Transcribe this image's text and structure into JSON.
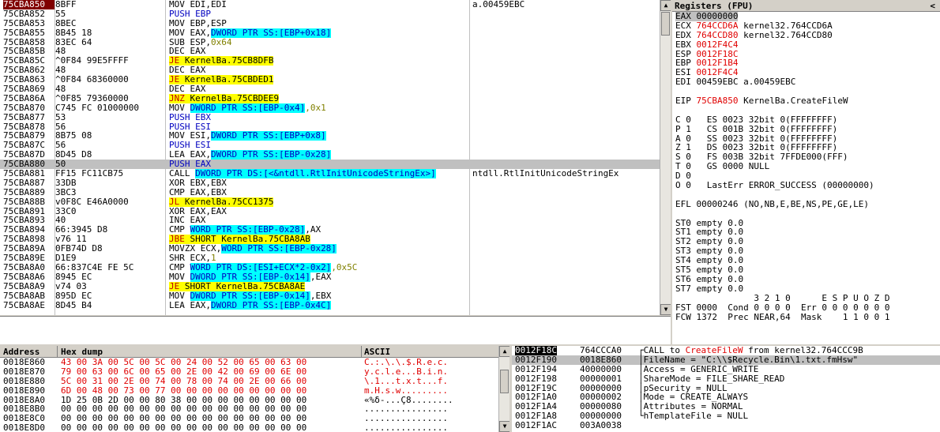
{
  "cpu": {
    "rows": [
      {
        "addr": "75CBA850",
        "hex": "8BFF",
        "dis": "MOV EDI,EDI",
        "cmt": "a.00459EBC",
        "eip": true
      },
      {
        "addr": "75CBA852",
        "hex": "55",
        "dis": "PUSH EBP",
        "cmt": ""
      },
      {
        "addr": "75CBA853",
        "hex": "8BEC",
        "dis": "MOV EBP,ESP",
        "cmt": ""
      },
      {
        "addr": "75CBA855",
        "hex": "8B45 18",
        "dis": "MOV EAX,DWORD PTR SS:[EBP+0x18]",
        "cmt": ""
      },
      {
        "addr": "75CBA858",
        "hex": "83EC 64",
        "dis": "SUB ESP,0x64",
        "cmt": ""
      },
      {
        "addr": "75CBA85B",
        "hex": "48",
        "dis": "DEC EAX",
        "cmt": ""
      },
      {
        "addr": "75CBA85C",
        "hex": "^0F84 99E5FFFF",
        "dis": "JE KernelBa.75CB8DFB",
        "cmt": ""
      },
      {
        "addr": "75CBA862",
        "hex": "48",
        "dis": "DEC EAX",
        "cmt": ""
      },
      {
        "addr": "75CBA863",
        "hex": "^0F84 68360000",
        "dis": "JE KernelBa.75CBDED1",
        "cmt": ""
      },
      {
        "addr": "75CBA869",
        "hex": "48",
        "dis": "DEC EAX",
        "cmt": ""
      },
      {
        "addr": "75CBA86A",
        "hex": "^0F85 79360000",
        "dis": "JNZ KernelBa.75CBDEE9",
        "cmt": ""
      },
      {
        "addr": "75CBA870",
        "hex": "C745 FC 01000000",
        "dis": "MOV DWORD PTR SS:[EBP-0x4],0x1",
        "cmt": ""
      },
      {
        "addr": "75CBA877",
        "hex": "53",
        "dis": "PUSH EBX",
        "cmt": ""
      },
      {
        "addr": "75CBA878",
        "hex": "56",
        "dis": "PUSH ESI",
        "cmt": ""
      },
      {
        "addr": "75CBA879",
        "hex": "8B75 08",
        "dis": "MOV ESI,DWORD PTR SS:[EBP+0x8]",
        "cmt": ""
      },
      {
        "addr": "75CBA87C",
        "hex": "56",
        "dis": "PUSH ESI",
        "cmt": ""
      },
      {
        "addr": "75CBA87D",
        "hex": "8D45 D8",
        "dis": "LEA EAX,DWORD PTR SS:[EBP-0x28]",
        "cmt": ""
      },
      {
        "addr": "75CBA880",
        "hex": "50",
        "dis": "PUSH EAX",
        "cmt": "",
        "sel": true
      },
      {
        "addr": "75CBA881",
        "hex": "FF15 FC11CB75",
        "dis": "CALL DWORD PTR DS:[<&ntdll.RtlInitUnicodeStringEx>]",
        "cmt": "ntdll.RtlInitUnicodeStringEx"
      },
      {
        "addr": "75CBA887",
        "hex": "33DB",
        "dis": "XOR EBX,EBX",
        "cmt": ""
      },
      {
        "addr": "75CBA889",
        "hex": "3BC3",
        "dis": "CMP EAX,EBX",
        "cmt": ""
      },
      {
        "addr": "75CBA88B",
        "hex": "v0F8C E46A0000",
        "dis": "JL KernelBa.75CC1375",
        "cmt": ""
      },
      {
        "addr": "75CBA891",
        "hex": "33C0",
        "dis": "XOR EAX,EAX",
        "cmt": ""
      },
      {
        "addr": "75CBA893",
        "hex": "40",
        "dis": "INC EAX",
        "cmt": ""
      },
      {
        "addr": "75CBA894",
        "hex": "66:3945 D8",
        "dis": "CMP WORD PTR SS:[EBP-0x28],AX",
        "cmt": ""
      },
      {
        "addr": "75CBA898",
        "hex": "v76 11",
        "dis": "JBE SHORT KernelBa.75CBA8AB",
        "cmt": ""
      },
      {
        "addr": "75CBA89A",
        "hex": "0FB74D D8",
        "dis": "MOVZX ECX,WORD PTR SS:[EBP-0x28]",
        "cmt": ""
      },
      {
        "addr": "75CBA89E",
        "hex": "D1E9",
        "dis": "SHR ECX,1",
        "cmt": ""
      },
      {
        "addr": "75CBA8A0",
        "hex": "66:837C4E FE 5C",
        "dis": "CMP WORD PTR DS:[ESI+ECX*2-0x2],0x5C",
        "cmt": ""
      },
      {
        "addr": "75CBA8A6",
        "hex": "8945 EC",
        "dis": "MOV DWORD PTR SS:[EBP-0x14],EAX",
        "cmt": ""
      },
      {
        "addr": "75CBA8A9",
        "hex": "v74 03",
        "dis": "JE SHORT KernelBa.75CBA8AE",
        "cmt": ""
      },
      {
        "addr": "75CBA8AB",
        "hex": "895D EC",
        "dis": "MOV DWORD PTR SS:[EBP-0x14],EBX",
        "cmt": ""
      },
      {
        "addr": "75CBA8AE",
        "hex": "8D45 B4",
        "dis": "LEA EAX,DWORD PTR SS:[EBP-0x4C]",
        "cmt": ""
      }
    ]
  },
  "registers": {
    "title": "Registers (FPU)",
    "collapse": "<",
    "lines": [
      {
        "t": "EAX 00000000",
        "hl": true
      },
      {
        "t": "ECX ",
        "r": "764CCD6A",
        "g": " kernel32.764CCD6A"
      },
      {
        "t": "EDX ",
        "r": "764CCD80",
        "g": " kernel32.764CCD80"
      },
      {
        "t": "EBX ",
        "r": "0012F4C4",
        "g": ""
      },
      {
        "t": "ESP ",
        "r": "0012F18C",
        "g": ""
      },
      {
        "t": "EBP ",
        "r": "0012F1B4",
        "g": ""
      },
      {
        "t": "ESI ",
        "r": "0012F4C4",
        "g": ""
      },
      {
        "t": "EDI 00459EBC a.00459EBC"
      },
      {
        "t": ""
      },
      {
        "t": "EIP ",
        "r": "75CBA850",
        "g": " KernelBa.CreateFileW"
      },
      {
        "t": ""
      },
      {
        "t": "C 0   ES 0023 32bit 0(FFFFFFFF)"
      },
      {
        "t": "P 1   CS 001B 32bit 0(FFFFFFFF)"
      },
      {
        "t": "A 0   SS 0023 32bit 0(FFFFFFFF)"
      },
      {
        "t": "Z 1   DS 0023 32bit 0(FFFFFFFF)"
      },
      {
        "t": "S 0   FS 003B 32bit 7FFDE000(FFF)"
      },
      {
        "t": "T 0   GS 0000 NULL"
      },
      {
        "t": "D 0"
      },
      {
        "t": "O 0   LastErr ERROR_SUCCESS (00000000)"
      },
      {
        "t": ""
      },
      {
        "t": "EFL 00000246 (NO,NB,E,BE,NS,PE,GE,LE)"
      },
      {
        "t": ""
      },
      {
        "t": "ST0 empty 0.0"
      },
      {
        "t": "ST1 empty 0.0"
      },
      {
        "t": "ST2 empty 0.0"
      },
      {
        "t": "ST3 empty 0.0"
      },
      {
        "t": "ST4 empty 0.0"
      },
      {
        "t": "ST5 empty 0.0"
      },
      {
        "t": "ST6 empty 0.0"
      },
      {
        "t": "ST7 empty 0.0"
      },
      {
        "t": "               3 2 1 0      E S P U O Z D"
      },
      {
        "t": "FST 0000  Cond 0 0 0 0  Err 0 0 0 0 0 0 0"
      },
      {
        "t": "FCW 1372  Prec NEAR,64  Mask    1 1 0 0 1"
      }
    ]
  },
  "dump": {
    "col_address": "Address",
    "col_hex": "Hex dump",
    "col_ascii": "ASCII",
    "rows": [
      {
        "addr": "0018E860",
        "hex": "43 00 3A 00 5C 00 5C 00 24 00 52 00 65 00 63 00",
        "ascii": "C.:.\\.\\.$.R.e.c."
      },
      {
        "addr": "0018E870",
        "hex": "79 00 63 00 6C 00 65 00 2E 00 42 00 69 00 6E 00",
        "ascii": "y.c.l.e...B.i.n."
      },
      {
        "addr": "0018E880",
        "hex": "5C 00 31 00 2E 00 74 00 78 00 74 00 2E 00 66 00",
        "ascii": "\\.1...t.x.t...f."
      },
      {
        "addr": "0018E890",
        "hex": "6D 00 48 00 73 00 77 00 00 00 00 00 00 00 00 00",
        "ascii": "m.H.s.w........."
      },
      {
        "addr": "0018E8A0",
        "hex": "1D 25 0B 2D 00 00 80 38 00 00 00 00 00 00 00 00",
        "ascii": "«%δ-...Ç8........"
      },
      {
        "addr": "0018E8B0",
        "hex": "00 00 00 00 00 00 00 00 00 00 00 00 00 00 00 00",
        "ascii": "................"
      },
      {
        "addr": "0018E8C0",
        "hex": "00 00 00 00 00 00 00 00 00 00 00 00 00 00 00 00",
        "ascii": "................"
      },
      {
        "addr": "0018E8D0",
        "hex": "00 00 00 00 00 00 00 00 00 00 00 00 00 00 00 00",
        "ascii": "................"
      }
    ]
  },
  "stack": {
    "rows": [
      {
        "addr": "0012F18C",
        "val": "764CCCA0",
        "br": "┌",
        "pre": "CALL to ",
        "fn": "CreateFileW",
        "post": " from kernel32.764CCC9B",
        "top": true
      },
      {
        "addr": "0012F190",
        "val": "0018E860",
        "br": "│",
        "pre": "FileName = \"C:\\\\$Recycle.Bin\\1.txt.fmHsw\"",
        "sel": true
      },
      {
        "addr": "0012F194",
        "val": "40000000",
        "br": "│",
        "pre": "Access = GENERIC_WRITE"
      },
      {
        "addr": "0012F198",
        "val": "00000001",
        "br": "│",
        "pre": "ShareMode = FILE_SHARE_READ"
      },
      {
        "addr": "0012F19C",
        "val": "00000000",
        "br": "│",
        "pre": "pSecurity = NULL"
      },
      {
        "addr": "0012F1A0",
        "val": "00000002",
        "br": "│",
        "pre": "Mode = CREATE_ALWAYS"
      },
      {
        "addr": "0012F1A4",
        "val": "00000080",
        "br": "│",
        "pre": "Attributes = NORMAL"
      },
      {
        "addr": "0012F1A8",
        "val": "00000000",
        "br": "└",
        "pre": "hTemplateFile = NULL"
      },
      {
        "addr": "0012F1AC",
        "val": "003A0038",
        "br": "",
        "pre": ""
      }
    ]
  }
}
